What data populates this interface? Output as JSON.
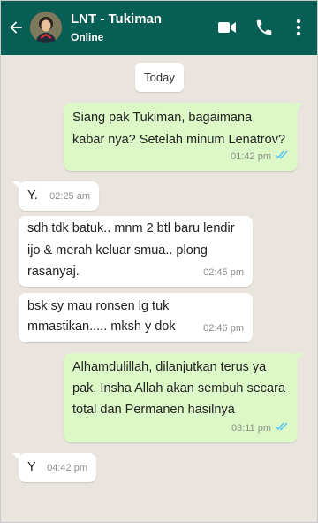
{
  "header": {
    "title": "LNT - Tukiman",
    "status": "Online",
    "icons": [
      "back-arrow-icon",
      "video-call-icon",
      "phone-icon",
      "more-vert-icon"
    ]
  },
  "chat": {
    "date_chip": "Today",
    "messages": [
      {
        "direction": "out",
        "lines": [
          "Siang pak Tukiman, bagaimana",
          "kabar nya? Setelah minum Lenatrov?"
        ],
        "time": "01:42 pm",
        "status": "read"
      },
      {
        "direction": "in",
        "lines": [
          "Y."
        ],
        "time": "02:25 am"
      },
      {
        "direction": "in",
        "lines": [
          "sdh tdk batuk.. mnm 2 btl baru lendir",
          "ijo & merah keluar smua.. plong",
          "rasanyaj."
        ],
        "time": "02:45 pm"
      },
      {
        "direction": "in",
        "lines": [
          "bsk sy mau ronsen lg tuk",
          "mmastikan..... mksh y dok"
        ],
        "time": "02:46 pm"
      },
      {
        "direction": "out",
        "lines": [
          "Alhamdulillah, dilanjutkan terus ya",
          "pak. Insha Allah akan sembuh secara",
          "total dan Permanen hasilnya"
        ],
        "time": "03:11 pm",
        "status": "read"
      },
      {
        "direction": "in",
        "lines": [
          "Y"
        ],
        "time": "04:42 pm"
      }
    ]
  },
  "colors": {
    "header_bg": "#075e54",
    "chat_bg": "#e9e4dd",
    "outgoing_bubble": "#dcf8c6",
    "incoming_bubble": "#ffffff",
    "read_ticks": "#4fc3f7"
  }
}
